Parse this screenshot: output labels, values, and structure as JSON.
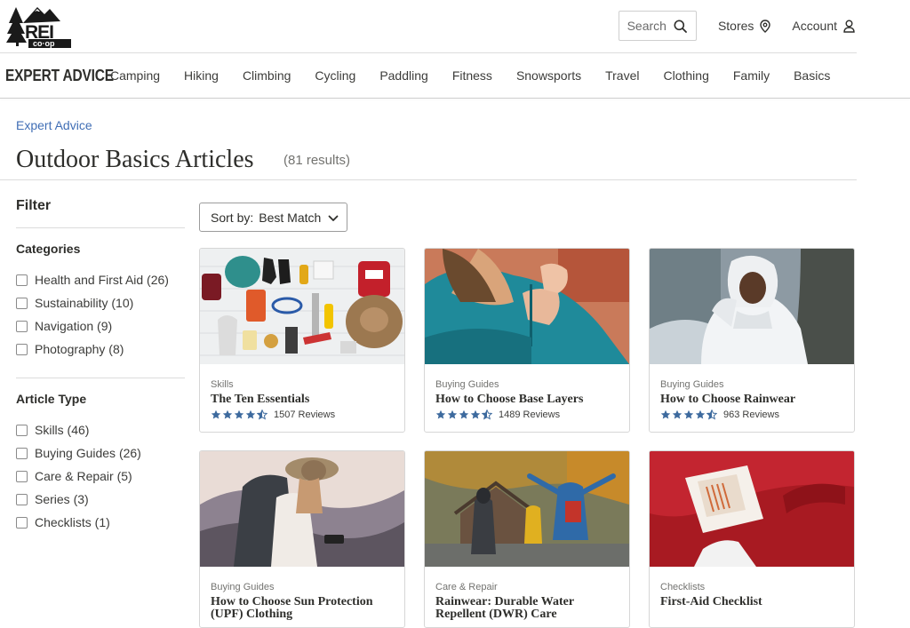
{
  "header": {
    "logo_text": "REI co-op",
    "search_label": "Search",
    "stores_label": "Stores",
    "account_label": "Account"
  },
  "nav": {
    "brand": "EXPERT ADVICE",
    "items": [
      "Camping",
      "Hiking",
      "Climbing",
      "Cycling",
      "Paddling",
      "Fitness",
      "Snowsports",
      "Travel",
      "Clothing",
      "Family",
      "Basics"
    ]
  },
  "breadcrumb": "Expert Advice",
  "page": {
    "title": "Outdoor Basics Articles",
    "results": "(81 results)"
  },
  "filters": {
    "title": "Filter",
    "categories": {
      "label": "Categories",
      "options": [
        "Health and First Aid (26)",
        "Sustainability (10)",
        "Navigation (9)",
        "Photography (8)"
      ]
    },
    "article_type": {
      "label": "Article Type",
      "options": [
        "Skills (46)",
        "Buying Guides (26)",
        "Care & Repair (5)",
        "Series (3)",
        "Checklists (1)"
      ]
    }
  },
  "sort": {
    "label": "Sort by:",
    "value": "Best Match"
  },
  "cards": [
    {
      "category": "Skills",
      "title": "The Ten Essentials",
      "rating": 4.5,
      "reviews": "1507 Reviews",
      "image": "ten-essentials-flatlay"
    },
    {
      "category": "Buying Guides",
      "title": "How to Choose Base Layers",
      "rating": 4.5,
      "reviews": "1489 Reviews",
      "image": "teal-base-layer-zipper"
    },
    {
      "category": "Buying Guides",
      "title": "How to Choose Rainwear",
      "rating": 4.5,
      "reviews": "963 Reviews",
      "image": "woman-in-white-rain-jacket"
    },
    {
      "category": "Buying Guides",
      "title": "How to Choose Sun Protection (UPF) Clothing",
      "image": "hiker-with-sun-hat-mountains"
    },
    {
      "category": "Care & Repair",
      "title": "Rainwear: Durable Water Repellent (DWR) Care",
      "image": "hikers-in-rain-by-cabin"
    },
    {
      "category": "Checklists",
      "title": "First-Aid Checklist",
      "image": "red-first-aid-kit"
    }
  ],
  "colors": {
    "link": "#406eb5",
    "star": "#3d6a9e",
    "text": "#2e2e2b"
  }
}
